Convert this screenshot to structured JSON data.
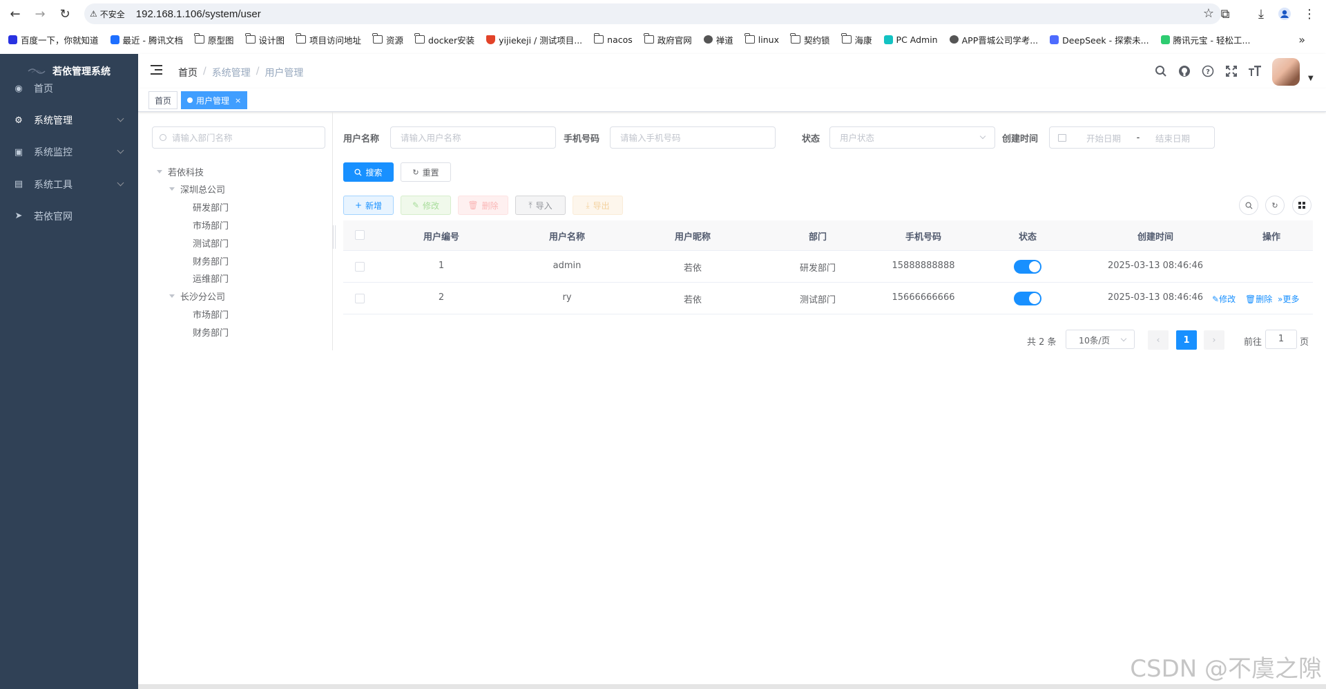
{
  "browser": {
    "security_label": "不安全",
    "url": "192.168.1.106/system/user",
    "bookmarks": [
      {
        "label": "百度一下，你就知道",
        "icon": "baidu-icon"
      },
      {
        "label": "最近 - 腾讯文档",
        "icon": "tencent-docs-icon"
      },
      {
        "label": "原型图",
        "icon": "folder-icon"
      },
      {
        "label": "设计图",
        "icon": "folder-icon"
      },
      {
        "label": "项目访问地址",
        "icon": "folder-icon"
      },
      {
        "label": "资源",
        "icon": "folder-icon"
      },
      {
        "label": "docker安装",
        "icon": "folder-icon"
      },
      {
        "label": "yijiekeji / 测试项目...",
        "icon": "gitlab-icon"
      },
      {
        "label": "nacos",
        "icon": "folder-icon"
      },
      {
        "label": "政府官网",
        "icon": "folder-icon"
      },
      {
        "label": "禅道",
        "icon": "globe-icon"
      },
      {
        "label": "linux",
        "icon": "folder-icon"
      },
      {
        "label": "契约锁",
        "icon": "folder-icon"
      },
      {
        "label": "海康",
        "icon": "folder-icon"
      },
      {
        "label": "PC Admin",
        "icon": "pcadmin-icon"
      },
      {
        "label": "APP晋城公司学考...",
        "icon": "globe-icon"
      },
      {
        "label": "DeepSeek - 探索未...",
        "icon": "deepseek-icon"
      },
      {
        "label": "腾讯元宝 - 轻松工...",
        "icon": "yuanbao-icon"
      }
    ],
    "more": "»"
  },
  "sidebar": {
    "title": "若依管理系统",
    "items": [
      {
        "label": "首页",
        "icon": "dashboard-icon",
        "has_children": false,
        "active": false
      },
      {
        "label": "系统管理",
        "icon": "gear-icon",
        "has_children": true,
        "active": true
      },
      {
        "label": "系统监控",
        "icon": "monitor-icon",
        "has_children": true,
        "active": false
      },
      {
        "label": "系统工具",
        "icon": "toolbox-icon",
        "has_children": true,
        "active": false
      },
      {
        "label": "若依官网",
        "icon": "send-icon",
        "has_children": false,
        "active": false
      }
    ]
  },
  "navbar": {
    "breadcrumb": [
      "首页",
      "系统管理",
      "用户管理"
    ],
    "separator": "/"
  },
  "tags": [
    {
      "label": "首页",
      "active": false
    },
    {
      "label": "用户管理",
      "active": true,
      "close": "×"
    }
  ],
  "dept": {
    "search_placeholder": "请输入部门名称",
    "tree": [
      {
        "label": "若依科技",
        "level": 0,
        "expandable": true
      },
      {
        "label": "深圳总公司",
        "level": 1,
        "expandable": true
      },
      {
        "label": "研发部门",
        "level": 2,
        "expandable": false
      },
      {
        "label": "市场部门",
        "level": 2,
        "expandable": false
      },
      {
        "label": "测试部门",
        "level": 2,
        "expandable": false
      },
      {
        "label": "财务部门",
        "level": 2,
        "expandable": false
      },
      {
        "label": "运维部门",
        "level": 2,
        "expandable": false
      },
      {
        "label": "长沙分公司",
        "level": 1,
        "expandable": true
      },
      {
        "label": "市场部门",
        "level": 2,
        "expandable": false
      },
      {
        "label": "财务部门",
        "level": 2,
        "expandable": false
      }
    ]
  },
  "search": {
    "username_label": "用户名称",
    "username_placeholder": "请输入用户名称",
    "phone_label": "手机号码",
    "phone_placeholder": "请输入手机号码",
    "status_label": "状态",
    "status_placeholder": "用户状态",
    "created_label": "创建时间",
    "start_placeholder": "开始日期",
    "range_sep": "-",
    "end_placeholder": "结束日期",
    "search_btn": "搜索",
    "reset_btn": "重置"
  },
  "toolbar": {
    "add": "新增",
    "edit": "修改",
    "delete": "删除",
    "import": "导入",
    "export": "导出"
  },
  "table": {
    "headers": [
      "用户编号",
      "用户名称",
      "用户昵称",
      "部门",
      "手机号码",
      "状态",
      "创建时间",
      "操作"
    ],
    "rows": [
      {
        "id": "1",
        "username": "admin",
        "nickname": "若依",
        "dept": "研发部门",
        "phone": "15888888888",
        "status": true,
        "created": "2025-03-13 08:46:46",
        "actions": []
      },
      {
        "id": "2",
        "username": "ry",
        "nickname": "若依",
        "dept": "测试部门",
        "phone": "15666666666",
        "status": true,
        "created": "2025-03-13 08:46:46",
        "actions": [
          "修改",
          "删除",
          "更多"
        ]
      }
    ]
  },
  "pagination": {
    "total": "共 2 条",
    "page_size": "10条/页",
    "current": "1",
    "goto_label": "前往",
    "goto_value": "1",
    "page_suffix": "页"
  },
  "watermark": "CSDN @不虞之隙",
  "colors": {
    "sidebar_bg": "#304156",
    "primary": "#1890ff",
    "tag_active": "#409eff"
  }
}
